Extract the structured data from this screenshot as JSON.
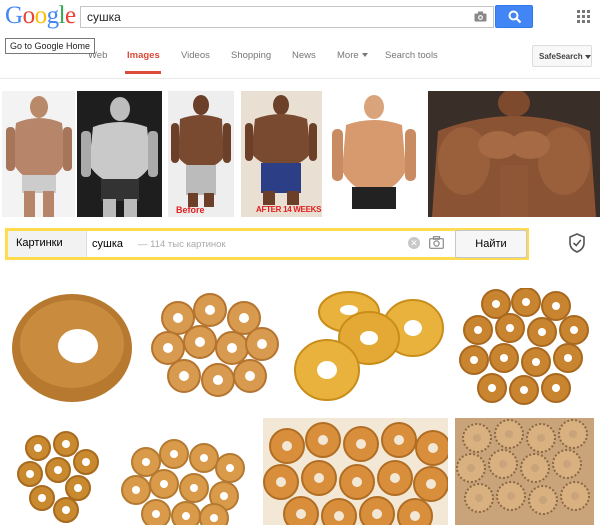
{
  "google": {
    "logo_letters": [
      {
        "ch": "G",
        "color": "#4285f4"
      },
      {
        "ch": "o",
        "color": "#ea4335"
      },
      {
        "ch": "o",
        "color": "#fbbc05"
      },
      {
        "ch": "g",
        "color": "#4285f4"
      },
      {
        "ch": "l",
        "color": "#34a853"
      },
      {
        "ch": "e",
        "color": "#ea4335"
      }
    ],
    "search_value": "сушка",
    "tooltip": "Go to Google Home",
    "tabs": {
      "web": "Web",
      "images": "Images",
      "videos": "Videos",
      "shopping": "Shopping",
      "news": "News",
      "more": "More",
      "search_tools": "Search tools"
    },
    "safesearch": "SafeSearch",
    "accent": "#dd4b39",
    "button_color": "#4285f4"
  },
  "strip_captions": {
    "before": "Before",
    "after": "AFTER 14 WEEKS"
  },
  "yandex": {
    "tab": "Картинки",
    "query": "сушка",
    "count": "— 114 тыс картинок",
    "clear_glyph": "✕",
    "button": "Найти",
    "accent": "#ffdb4d"
  }
}
